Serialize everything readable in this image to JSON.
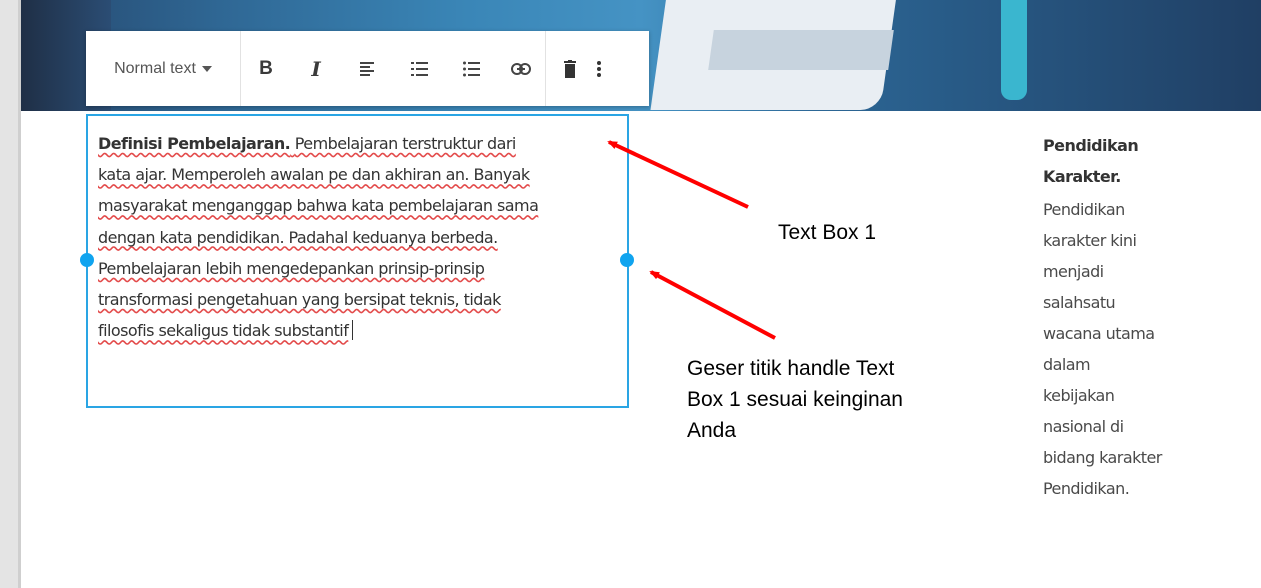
{
  "toolbar": {
    "style_label": "Normal text",
    "icons": [
      "bold-icon",
      "italic-icon",
      "align-left-icon",
      "numbered-list-icon",
      "bulleted-list-icon",
      "link-icon",
      "delete-icon",
      "more-vertical-icon"
    ]
  },
  "textbox": {
    "bold_title": "Definisi Pembelajaran.",
    "line1_rest": "Pembelajaran terstruktur dari",
    "lines": [
      "kata ajar. Memperoleh awalan pe dan akhiran an. Banyak",
      "masyarakat menganggap bahwa kata pembelajaran sama",
      "dengan kata pendidikan. Padahal keduanya berbeda.",
      "Pembelajaran lebih mengedepankan prinsip-prinsip",
      "transformasi pengetahuan yang bersipat teknis, tidak",
      "filosofis sekaligus tidak substantif"
    ]
  },
  "sidebar_text": {
    "title": [
      "Pendidikan",
      "Karakter."
    ],
    "body": [
      "Pendidikan",
      "karakter kini",
      "menjadi",
      "salahsatu",
      "wacana utama",
      "dalam",
      "kebijakan",
      "nasional di",
      "bidang karakter",
      "Pendidikan."
    ]
  },
  "annotations": {
    "label1": "Text Box 1",
    "label2_lines": [
      "Geser titik handle Text",
      "Box 1 sesuai keinginan",
      "Anda"
    ]
  },
  "colors": {
    "selection_border": "#2aa5e4",
    "handle": "#10a4ef",
    "arrow": "#ff0000",
    "spellcheck": "#e34b4b"
  }
}
